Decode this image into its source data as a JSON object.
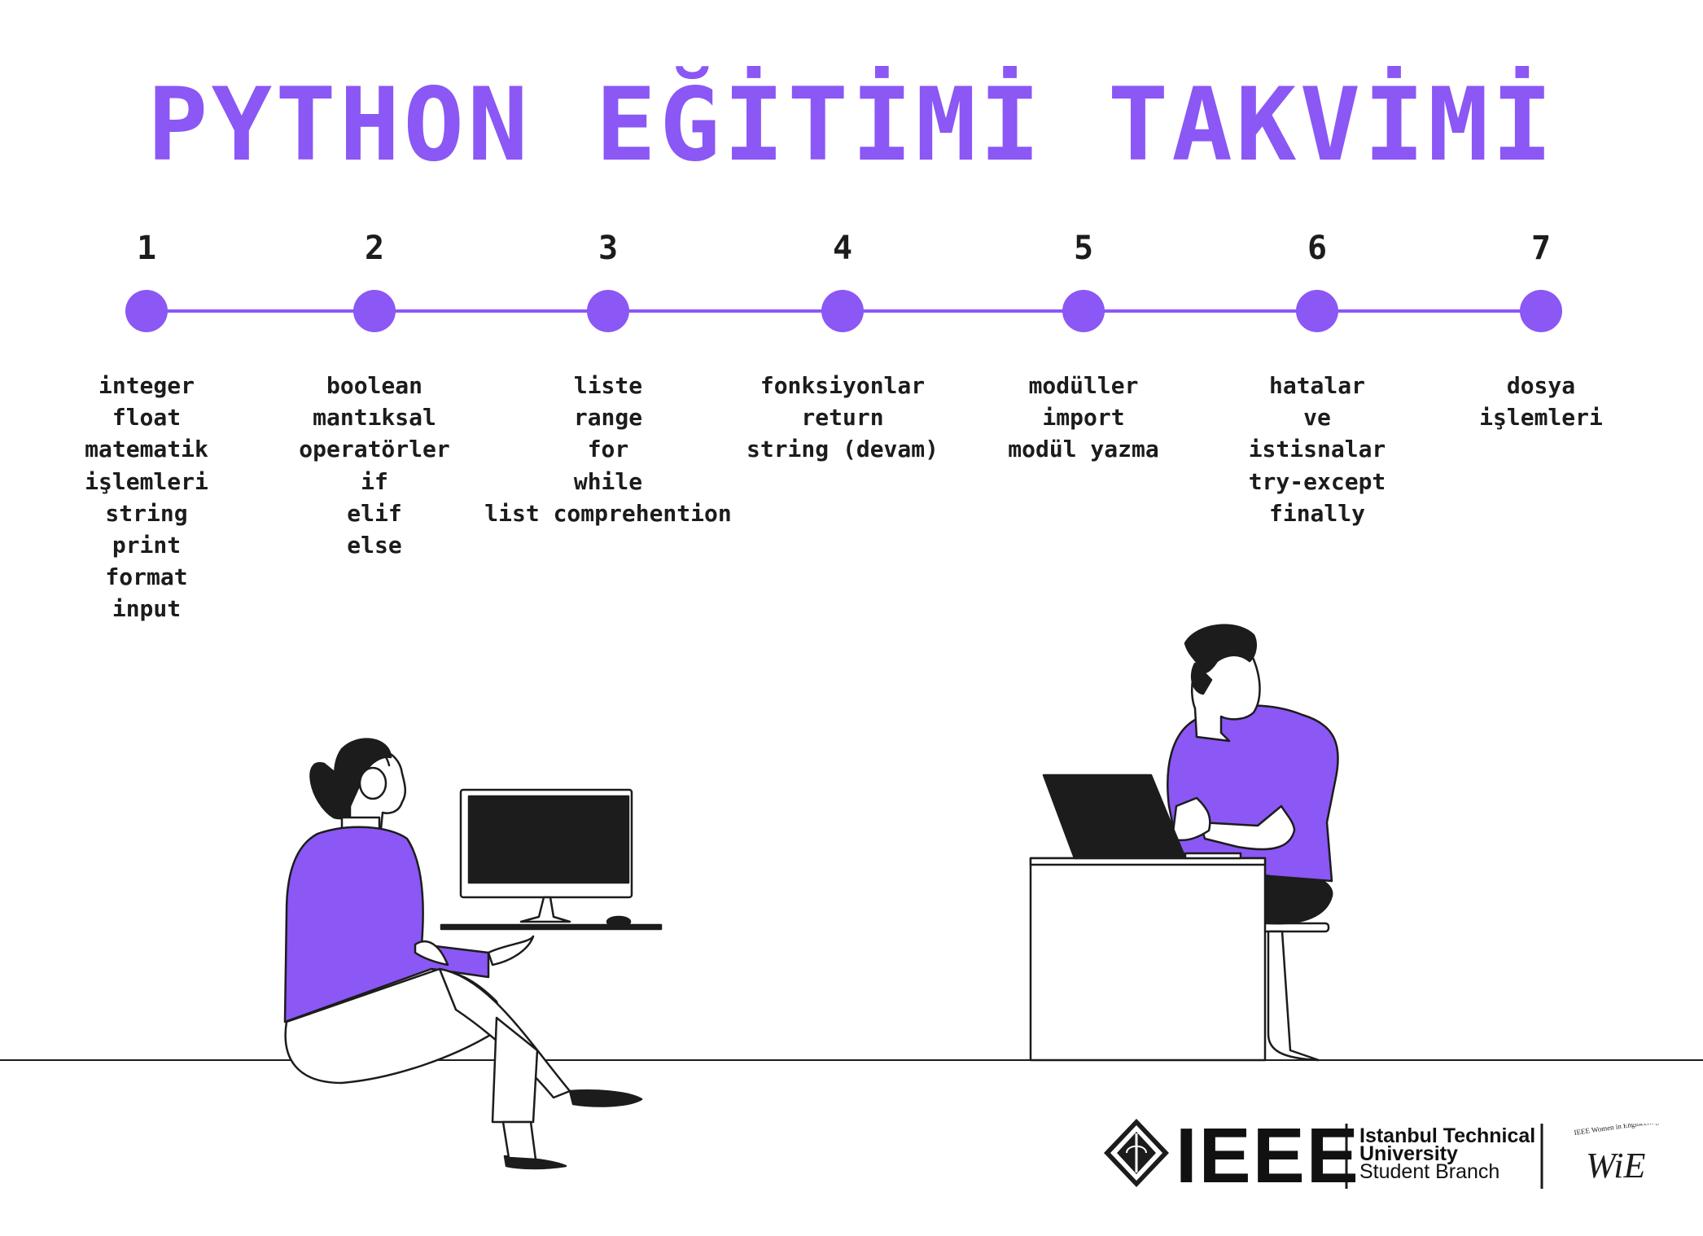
{
  "title": "PYTHON EĞİTİMİ TAKVİMİ",
  "accent_color": "#8b57f5",
  "text_color": "#1c1c1c",
  "steps": [
    {
      "number": "1",
      "topics": [
        "integer",
        "float",
        "matematik",
        "işlemleri",
        "string",
        "print",
        "format",
        "input"
      ]
    },
    {
      "number": "2",
      "topics": [
        "boolean",
        "mantıksal",
        "operatörler",
        "if",
        "elif",
        "else"
      ]
    },
    {
      "number": "3",
      "topics": [
        "liste",
        "range",
        "for",
        "while",
        "list comprehention"
      ]
    },
    {
      "number": "4",
      "topics": [
        "fonksiyonlar",
        "return",
        "string (devam)"
      ]
    },
    {
      "number": "5",
      "topics": [
        "modüller",
        "import",
        "modül yazma"
      ]
    },
    {
      "number": "6",
      "topics": [
        "hatalar",
        "ve",
        "istisnalar",
        "try-except",
        "finally"
      ]
    },
    {
      "number": "7",
      "topics": [
        "dosya",
        "işlemleri"
      ]
    }
  ],
  "logos": {
    "ieee": "IEEE",
    "branch_lines": [
      "Istanbul Technical",
      "University",
      "Student Branch"
    ],
    "wie_small": "IEEE Women in Engineering",
    "wie_mark": "WiE"
  }
}
